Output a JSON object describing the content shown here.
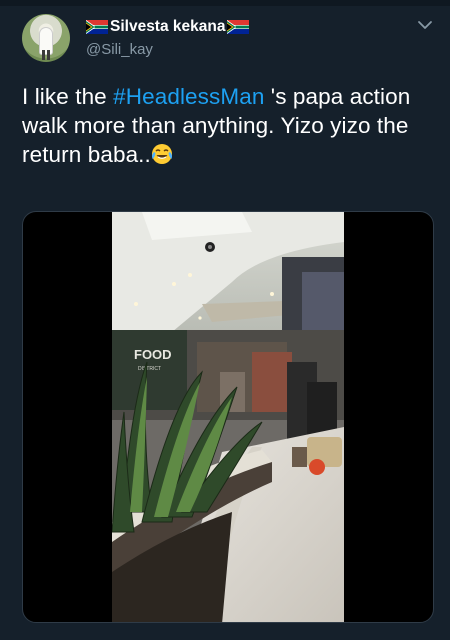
{
  "user": {
    "display_name": "Silvesta kekana",
    "handle": "@Sili_kay",
    "avatar_icon": "profile-photo",
    "flag_icon": "south-africa-flag"
  },
  "tweet": {
    "text_before": "I like the ",
    "hashtag": "#HeadlessMan",
    "text_after": " 's papa action walk more than anything. Yizo yizo the return baba..",
    "emoji_icon": "face-with-tears-of-joy"
  },
  "menu_icon": "chevron-down-icon",
  "media": {
    "type": "video",
    "sign_text": "FOOD",
    "sign_subtext": "DISTRICT"
  },
  "colors": {
    "background": "#15202b",
    "hashtag": "#1da1f2",
    "secondary_text": "#8899a6"
  }
}
